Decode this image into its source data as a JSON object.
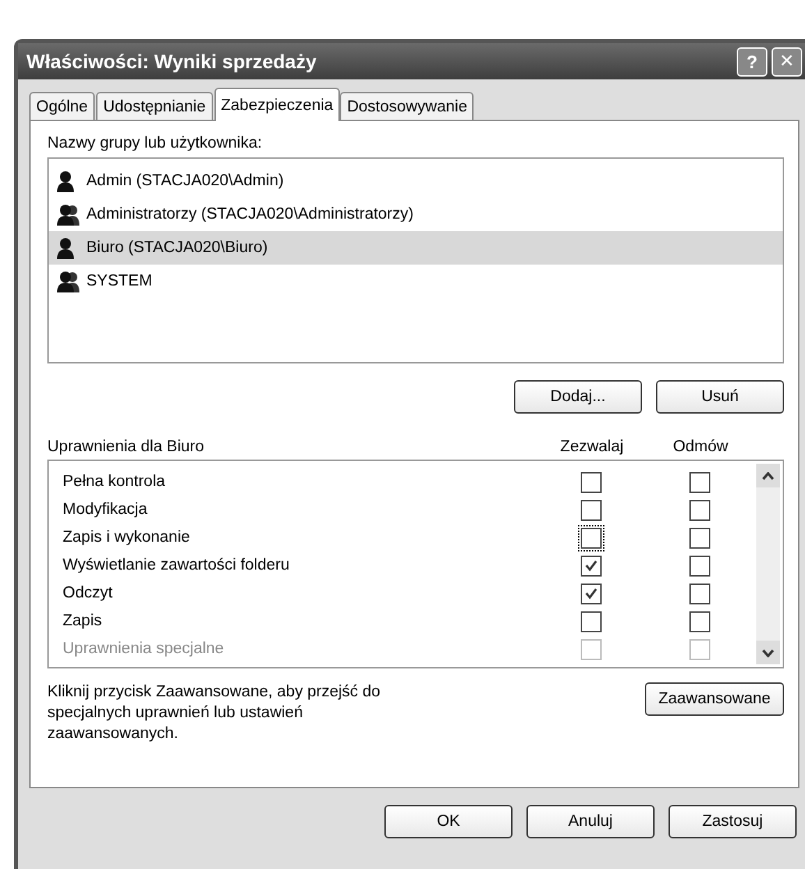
{
  "window": {
    "title": "Właściwości: Wyniki sprzedaży",
    "help_button": "?",
    "close_button": "✕"
  },
  "tabs": [
    {
      "label": "Ogólne",
      "selected": false
    },
    {
      "label": "Udostępnianie",
      "selected": false
    },
    {
      "label": "Zabezpieczenia",
      "selected": true
    },
    {
      "label": "Dostosowywanie",
      "selected": false
    }
  ],
  "principals": {
    "label": "Nazwy grupy lub użytkownika:",
    "items": [
      {
        "kind": "user",
        "name": "Admin (STACJA020\\Admin)",
        "selected": false
      },
      {
        "kind": "group",
        "name": "Administratorzy (STACJA020\\Administratorzy)",
        "selected": false
      },
      {
        "kind": "user",
        "name": "Biuro (STACJA020\\Biuro)",
        "selected": true
      },
      {
        "kind": "group",
        "name": "SYSTEM",
        "selected": false
      }
    ],
    "buttons": [
      "Dodaj...",
      "Usuń"
    ]
  },
  "permissions": {
    "label": "Uprawnienia dla Biuro",
    "allow_header": "Zezwalaj",
    "deny_header": "Odmów",
    "rows": [
      {
        "name": "Pełna kontrola",
        "allow": false,
        "deny": false,
        "disabled": false,
        "focused": false
      },
      {
        "name": "Modyfikacja",
        "allow": false,
        "deny": false,
        "disabled": false,
        "focused": false
      },
      {
        "name": "Zapis i wykonanie",
        "allow": false,
        "deny": false,
        "disabled": false,
        "focused": true
      },
      {
        "name": "Wyświetlanie zawartości folderu",
        "allow": true,
        "deny": false,
        "disabled": false,
        "focused": false
      },
      {
        "name": "Odczyt",
        "allow": true,
        "deny": false,
        "disabled": false,
        "focused": false
      },
      {
        "name": "Zapis",
        "allow": false,
        "deny": false,
        "disabled": false,
        "focused": false
      },
      {
        "name": "Uprawnienia specjalne",
        "allow": false,
        "deny": false,
        "disabled": true,
        "focused": false
      }
    ]
  },
  "advanced": {
    "text": "Kliknij przycisk Zaawansowane, aby przejść do specjalnych uprawnień lub ustawień zaawansowanych.",
    "button": "Zaawansowane"
  },
  "footer_buttons": [
    "OK",
    "Anuluj",
    "Zastosuj"
  ]
}
